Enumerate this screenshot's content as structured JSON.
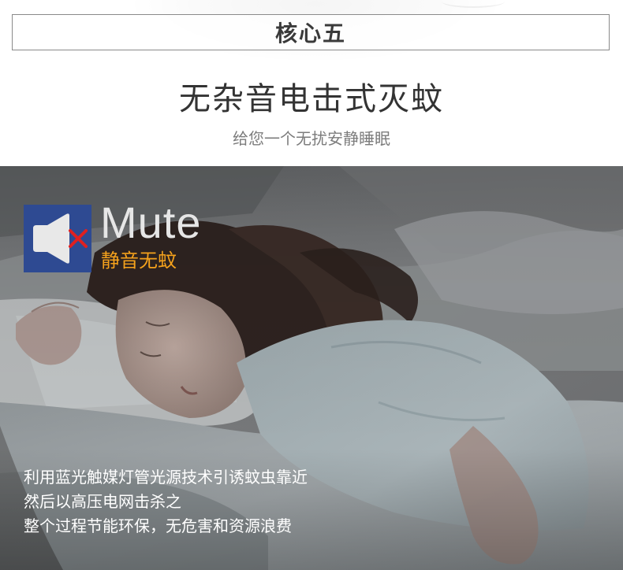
{
  "top": {
    "core_label": "核心五",
    "headline": "无杂音电击式灭蚊",
    "subline": "给您一个无扰安静睡眠"
  },
  "feature": {
    "title_en": "Mute",
    "title_cn": "静音无蚊",
    "icon": "muted-speaker-icon",
    "colors": {
      "badge_bg": "#2e4a92",
      "speaker": "#e8e8e8",
      "cross": "#e02020",
      "title_cn": "#f5a21c"
    }
  },
  "description": {
    "lines": [
      "利用蓝光触媒灯管光源技术引诱蚊虫靠近",
      "然后以高压电网击杀之",
      "整个过程节能环保，无危害和资源浪费"
    ]
  },
  "photo": {
    "subject": "sleeping-woman-photo"
  }
}
